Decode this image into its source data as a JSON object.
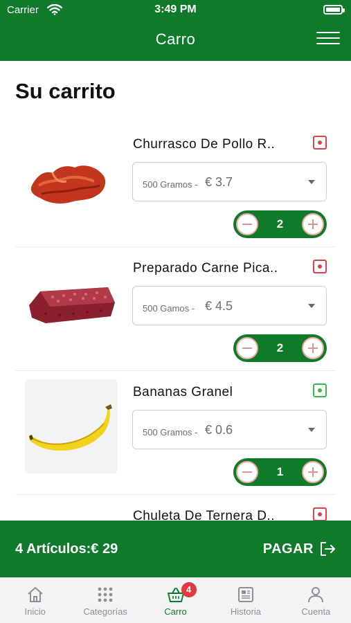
{
  "status_bar": {
    "carrier": "Carrier",
    "time": "3:49 PM"
  },
  "header": {
    "title": "Carro",
    "menu_icon": "hamburger-menu-icon"
  },
  "page": {
    "title": "Su carrito"
  },
  "cart": {
    "items": [
      {
        "name": "Churrasco De Pollo R..",
        "weight": "500 Gramos -",
        "price": "€ 3.7",
        "qty": "2",
        "remove_color": "#d9414b"
      },
      {
        "name": "Preparado Carne Pica..",
        "weight": "500 Gamos -",
        "price": "€ 4.5",
        "qty": "2",
        "remove_color": "#d9414b"
      },
      {
        "name": "Bananas Granel",
        "weight": "500 Gramos -",
        "price": "€ 0.6",
        "qty": "1",
        "remove_color": "#3cb64a"
      },
      {
        "name": "Chuleta De Ternera D..",
        "remove_color": "#d9414b"
      }
    ]
  },
  "checkout": {
    "total": "4 Artículos:€ 29",
    "pay_label": "PAGAR"
  },
  "tabbar": {
    "tabs": [
      {
        "label": "Inicio",
        "icon": "home-icon"
      },
      {
        "label": "Categorías",
        "icon": "grid-icon"
      },
      {
        "label": "Carro",
        "icon": "basket-icon",
        "badge": "4",
        "active": true
      },
      {
        "label": "Historia",
        "icon": "newspaper-icon"
      },
      {
        "label": "Cuenta",
        "icon": "user-icon"
      }
    ]
  },
  "colors": {
    "brand_green": "#0f7a2a",
    "badge_red": "#e0393e",
    "remove_red": "#d9414b",
    "remove_green": "#3cb64a"
  }
}
